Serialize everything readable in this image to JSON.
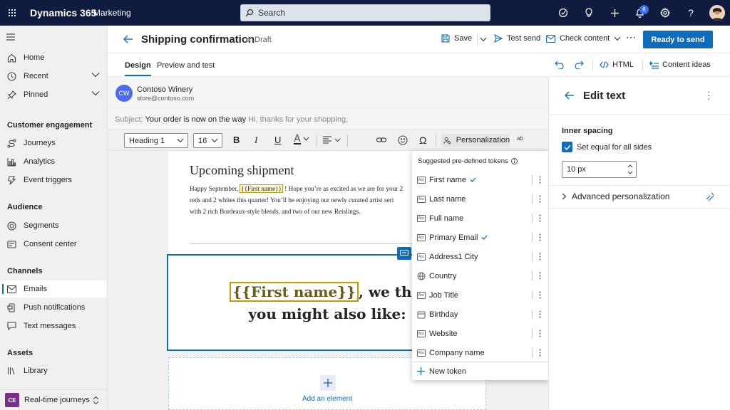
{
  "topbar": {
    "app_name": "Dynamics 365",
    "area_name": "Marketing",
    "search_placeholder": "Search",
    "notification_count": "8"
  },
  "nav": {
    "home": "Home",
    "recent": "Recent",
    "pinned": "Pinned",
    "sections": [
      {
        "title": "Customer engagement",
        "items": [
          "Journeys",
          "Analytics",
          "Event triggers"
        ]
      },
      {
        "title": "Audience",
        "items": [
          "Segments",
          "Consent center"
        ]
      },
      {
        "title": "Channels",
        "items": [
          "Emails",
          "Push notifications",
          "Text messages"
        ]
      },
      {
        "title": "Assets",
        "items": [
          "Library"
        ]
      }
    ],
    "area_switcher": {
      "initials": "CE",
      "label": "Real-time journeys"
    }
  },
  "header": {
    "title": "Shipping confirmation",
    "status": "Draft",
    "save": "Save",
    "test_send": "Test send",
    "check_content": "Check content",
    "ready_to_send": "Ready to send"
  },
  "tabs": {
    "design": "Design",
    "preview": "Preview and test",
    "html": "HTML",
    "content_ideas": "Content ideas"
  },
  "sender": {
    "initials": "CW",
    "name": "Contoso Winery",
    "email": "store@contoso.com",
    "subject_label": "Subject:",
    "subject": "Your order is now on the way",
    "preheader": "Hi, thanks for your shopping."
  },
  "toolbar": {
    "style": "Heading 1",
    "size": "16",
    "personalization": "Personalization"
  },
  "email": {
    "heading": "Upcoming shipment",
    "para_before": "Happy September,",
    "token_small": "{{First name}}",
    "para_after_1": "! Hope you’re as excited as we are for your 2",
    "para_line2": "reds and 2 whites this quarter! You’ll be enjoying our newly curated artist seri",
    "para_line3": "with 2 rich Bordeaux-style blends, and two of our new Reislings.",
    "big_token": "{{First name}}",
    "big_after": ", we thir",
    "big_line2": "you might also like:",
    "add_element": "Add an element"
  },
  "popup": {
    "header": "Suggested pre-defined tokens",
    "tokens": [
      {
        "label": "First name",
        "checked": true
      },
      {
        "label": "Last name",
        "checked": false
      },
      {
        "label": "Full name",
        "checked": false
      },
      {
        "label": "Primary Email",
        "checked": true
      },
      {
        "label": "Address1 City",
        "checked": false
      },
      {
        "label": "Country",
        "checked": false
      },
      {
        "label": "Job Title",
        "checked": false
      },
      {
        "label": "Birthday",
        "checked": false
      },
      {
        "label": "Website",
        "checked": false
      },
      {
        "label": "Company name",
        "checked": false
      }
    ],
    "new_token": "New token"
  },
  "panel": {
    "title": "Edit text",
    "inner_spacing": "Inner spacing",
    "set_equal": "Set equal for all sides",
    "spacing_value": "10 px",
    "advanced": "Advanced personalization"
  },
  "colors": {
    "topbar": "#0f1c3f",
    "accent": "#0f6cbd",
    "token_border": "#c19c00"
  }
}
